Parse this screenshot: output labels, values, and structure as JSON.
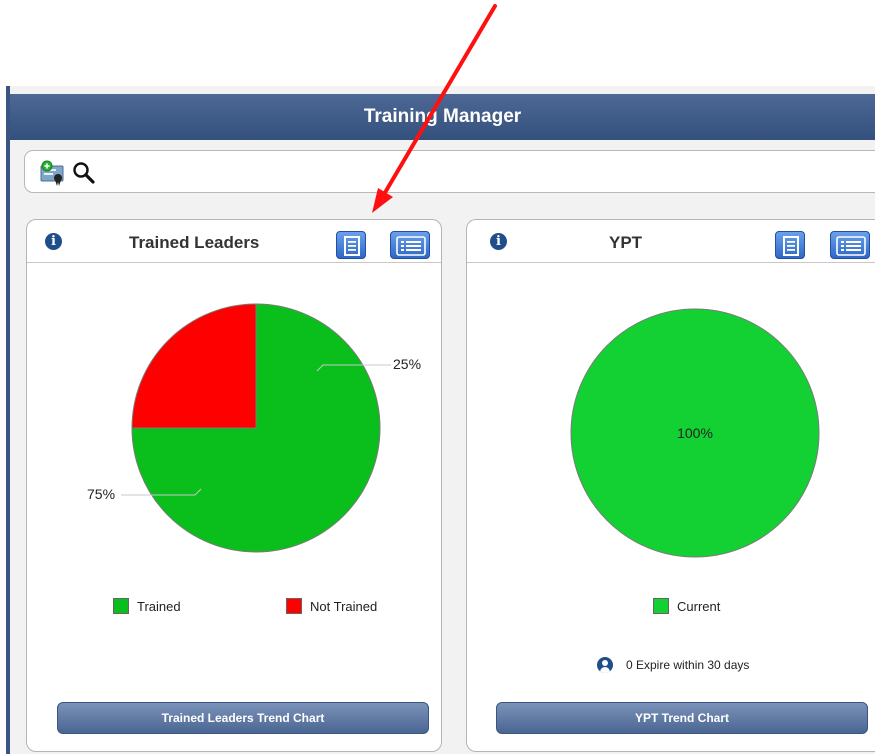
{
  "app": {
    "title": "Training Manager"
  },
  "toolbar": {
    "icons": [
      "certificate-add-icon",
      "search-icon"
    ]
  },
  "panels": {
    "trained": {
      "title": "Trained Leaders",
      "labels": {
        "not_trained_pct": "25%",
        "trained_pct": "75%"
      },
      "legend": {
        "trained": "Trained",
        "not_trained": "Not Trained"
      },
      "trend_button": "Trained Leaders Trend Chart"
    },
    "ypt": {
      "title": "YPT",
      "labels": {
        "current_pct": "100%"
      },
      "legend": {
        "current": "Current"
      },
      "expire_text": "0 Expire within 30 days",
      "trend_button": "YPT Trend Chart"
    }
  },
  "colors": {
    "green": "#0abf1b",
    "red": "#ff0000",
    "header_blue": "#3b5581",
    "button_blue": "#2d68c8"
  },
  "chart_data": [
    {
      "type": "pie",
      "title": "Trained Leaders",
      "categories": [
        "Trained",
        "Not Trained"
      ],
      "values": [
        75,
        25
      ],
      "colors": [
        "#0abf1b",
        "#ff0000"
      ],
      "legend": "bottom"
    },
    {
      "type": "pie",
      "title": "YPT",
      "categories": [
        "Current"
      ],
      "values": [
        100
      ],
      "colors": [
        "#13d133"
      ],
      "legend": "bottom"
    }
  ]
}
